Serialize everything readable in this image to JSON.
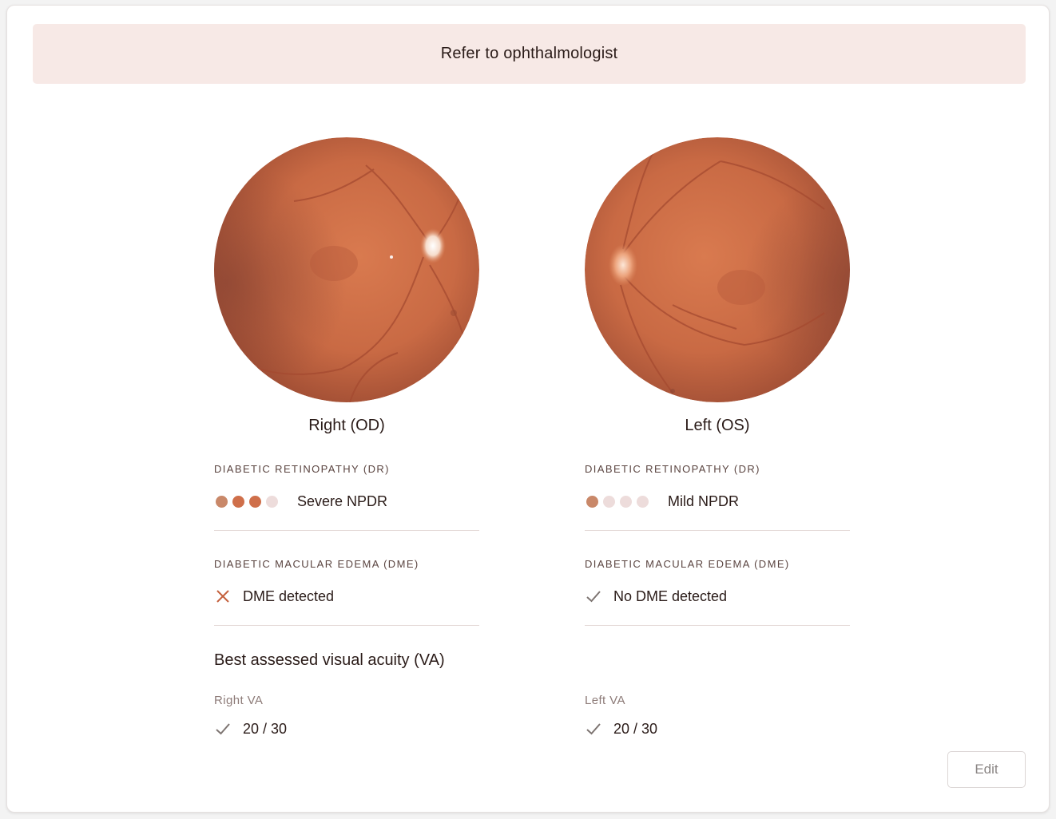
{
  "banner": {
    "text": "Refer to ophthalmologist"
  },
  "eyes": {
    "right": {
      "label": "Right (OD)",
      "dr_title": "DIABETIC RETINOPATHY (DR)",
      "dr_grade": "Severe NPDR",
      "dr_level": 3,
      "dr_max": 4,
      "dme_title": "DIABETIC MACULAR EDEMA (DME)",
      "dme_status": "DME detected",
      "dme_icon": "close-icon",
      "dme_color": "#c4613d"
    },
    "left": {
      "label": "Left (OS)",
      "dr_title": "DIABETIC RETINOPATHY (DR)",
      "dr_grade": "Mild NPDR",
      "dr_level": 1,
      "dr_max": 4,
      "dme_title": "DIABETIC MACULAR EDEMA (DME)",
      "dme_status": "No DME detected",
      "dme_icon": "check-icon",
      "dme_color": "#7d7471"
    }
  },
  "va": {
    "heading": "Best assessed visual acuity (VA)",
    "right": {
      "label": "Right VA",
      "value": "20 / 30"
    },
    "left": {
      "label": "Left VA",
      "value": "20 / 30"
    }
  },
  "actions": {
    "edit_label": "Edit"
  },
  "colors": {
    "accent": "#cf6f4a",
    "banner_bg": "#f7e9e6",
    "fundus_base": "#cf7048"
  }
}
